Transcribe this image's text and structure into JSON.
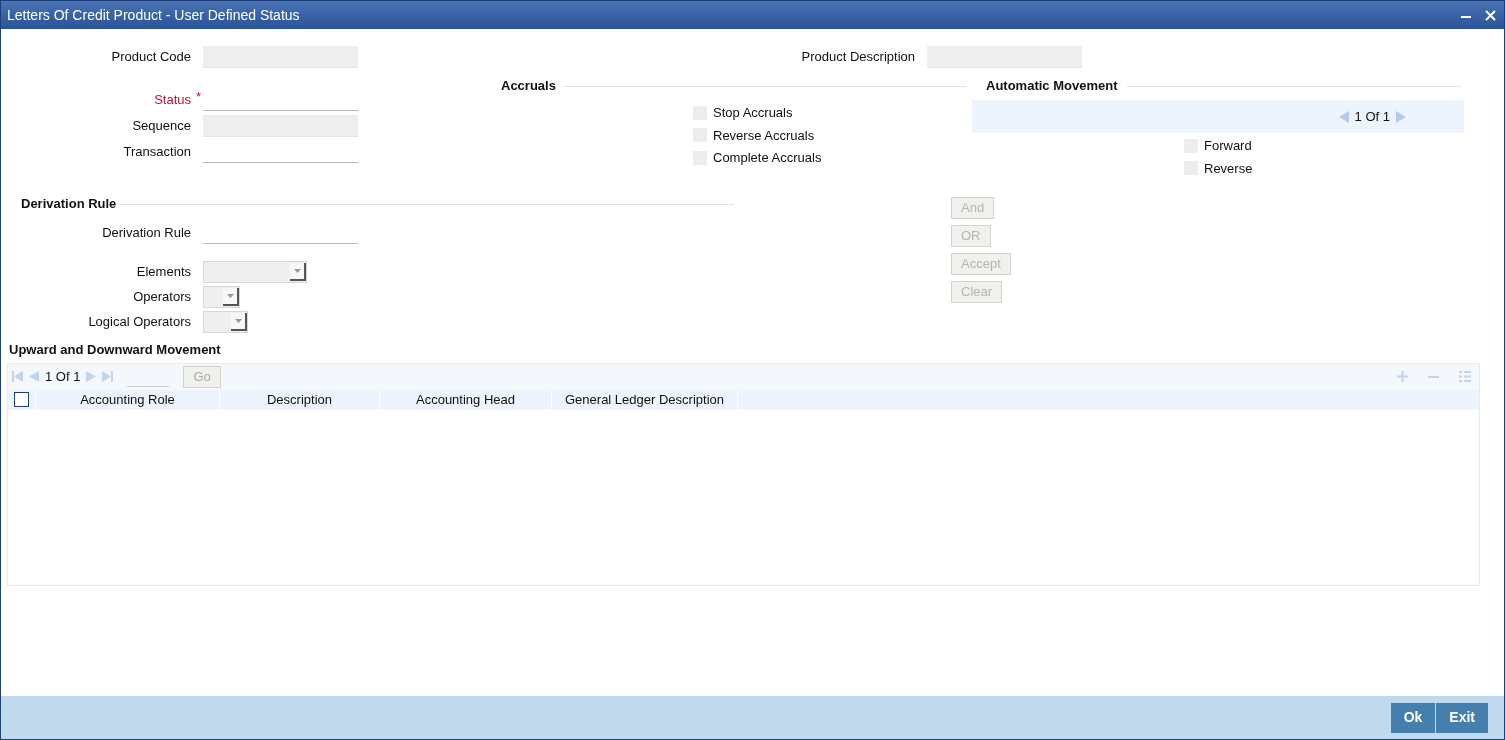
{
  "window": {
    "title": "Letters Of Credit Product - User Defined Status"
  },
  "header_fields": [
    {
      "label": "Product Code",
      "disabled": true
    },
    {
      "label": "Product Description",
      "disabled": true
    }
  ],
  "main_fields": [
    {
      "label": "Status",
      "required_mark": "*",
      "disabled": false
    },
    {
      "label": "Sequence",
      "disabled": true
    },
    {
      "label": "Transaction",
      "disabled": false
    }
  ],
  "accruals": {
    "title": "Accruals",
    "options": [
      {
        "label": "Stop Accruals",
        "checked": false
      },
      {
        "label": "Reverse Accruals",
        "checked": false
      },
      {
        "label": "Complete Accruals",
        "checked": false
      }
    ]
  },
  "automatic_movement": {
    "title": "Automatic Movement",
    "pager": "1 Of 1",
    "options": [
      {
        "label": "Forward",
        "checked": false
      },
      {
        "label": "Reverse",
        "checked": false
      }
    ]
  },
  "derivation": {
    "title": "Derivation Rule",
    "rule_field": {
      "label": "Derivation Rule"
    },
    "selects": [
      {
        "label": "Elements"
      },
      {
        "label": "Operators"
      },
      {
        "label": "Logical Operators"
      }
    ],
    "buttons": [
      {
        "label": "And",
        "disabled": true
      },
      {
        "label": "OR",
        "disabled": true
      },
      {
        "label": "Accept",
        "disabled": true
      },
      {
        "label": "Clear",
        "disabled": true
      }
    ]
  },
  "movement_grid": {
    "title": "Upward and Downward Movement",
    "pager": "1 Of 1",
    "go_button": "Go",
    "select_all_checked": false,
    "columns": [
      "Accounting Role",
      "Description",
      "Accounting Head",
      "General Ledger Description"
    ]
  },
  "footer_buttons": [
    "Ok",
    "Exit"
  ]
}
